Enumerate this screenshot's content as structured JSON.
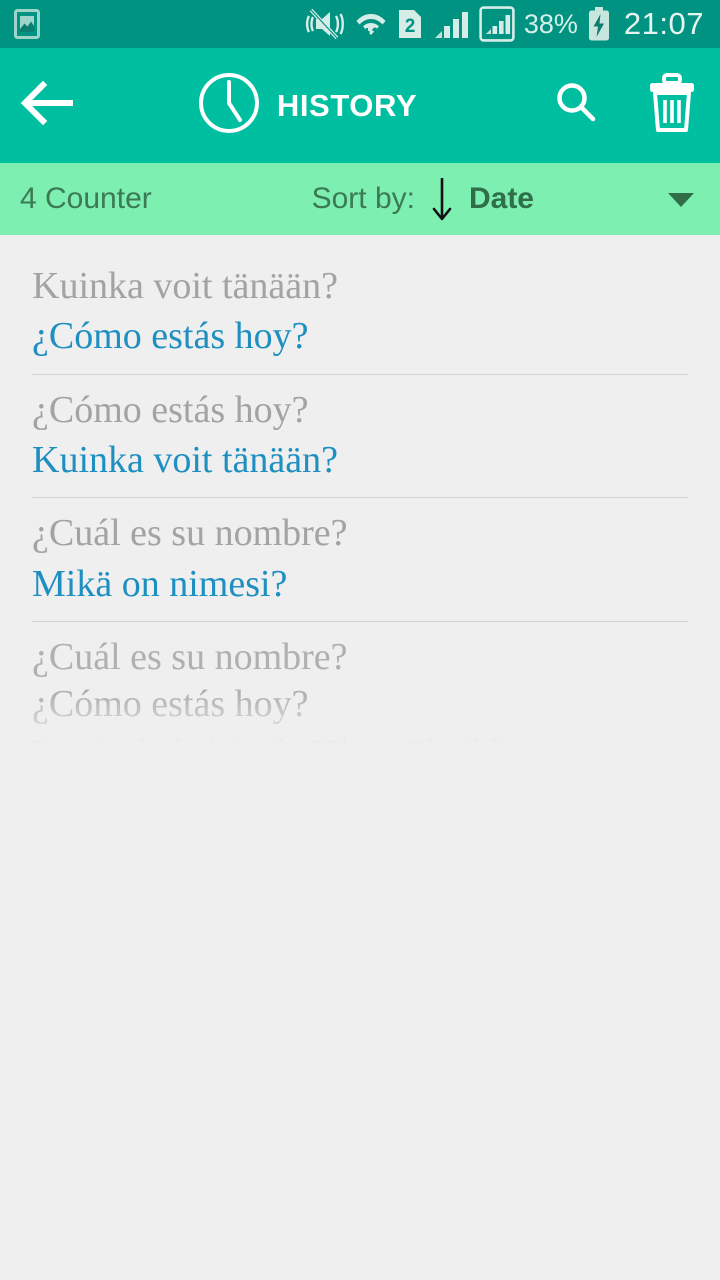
{
  "status_bar": {
    "icons": [
      "gallery-image-icon",
      "vibrate-mute-icon",
      "wifi-icon",
      "sim-2-icon",
      "signal-bars-icon",
      "signal-boxed-icon"
    ],
    "battery_percent": "38%",
    "battery_state": "charging",
    "clock": "21:07",
    "background_color": "#009382"
  },
  "app_bar": {
    "back_label": "back-arrow",
    "title": "HISTORY",
    "clock_icon": "clock-icon",
    "search_label": "search",
    "delete_label": "delete-all",
    "background_color": "#00bfa0"
  },
  "sort_bar": {
    "counter": "4 Counter",
    "sort_by_label": "Sort by:",
    "direction": "descending",
    "sort_value": "Date",
    "dropdown": "chevron-down-icon",
    "background_color": "#7defb1"
  },
  "list": {
    "items": [
      {
        "source": "Kuinka voit tänään?",
        "target": "¿Cómo estás hoy?",
        "faded": false
      },
      {
        "source": "¿Cómo estás hoy?",
        "target": "Kuinka voit tänään?",
        "faded": false
      },
      {
        "source": "¿Cuál es su nombre?",
        "target": "Mikä on nimesi?",
        "faded": false
      },
      {
        "source": "¿Cuál es su nombre?",
        "target": "¿Cómo estás hoy?",
        "extra": "La ciudad siria de Khan Sheikhoun, en",
        "faded": true
      }
    ],
    "background_color": "#efefef",
    "source_color": "#a3a3a3",
    "target_color": "#1e8fc0"
  }
}
